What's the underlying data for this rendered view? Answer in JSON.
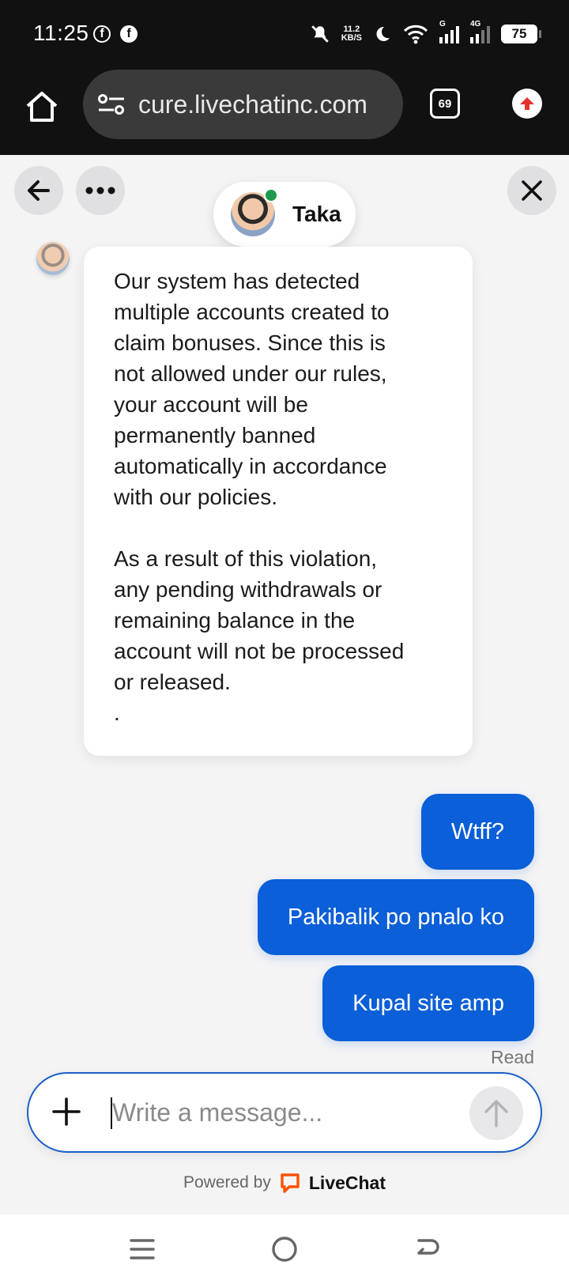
{
  "status_bar": {
    "time": "11:25",
    "net_speed_top": "11.2",
    "net_speed_bottom": "KB/S",
    "sim1_tag": "G",
    "sim2_tag": "4G",
    "battery": "75"
  },
  "browser": {
    "url": "cure.livechatinc.com",
    "tab_count": "69"
  },
  "chat": {
    "agent_name": "Taka",
    "agent_status_color": "#1d9a4d",
    "agent_message": "Our system has detected\nmultiple accounts created to\nclaim bonuses. Since this is\nnot allowed under our rules,\nyour account will be\npermanently banned\nautomatically in accordance\nwith our policies.\n\nAs a result of this violation,\nany pending withdrawals or\nremaining balance in the\naccount will not be processed\nor released.\n.",
    "user_messages": [
      "Wtff?",
      "Pakibalik po pnalo ko",
      "Kupal site amp"
    ],
    "read_label": "Read",
    "accent_color": "#0b5fd8"
  },
  "composer": {
    "placeholder": "Write a message..."
  },
  "footer": {
    "powered_by": "Powered by",
    "brand": "LiveChat",
    "brand_color": "#ff5100"
  }
}
